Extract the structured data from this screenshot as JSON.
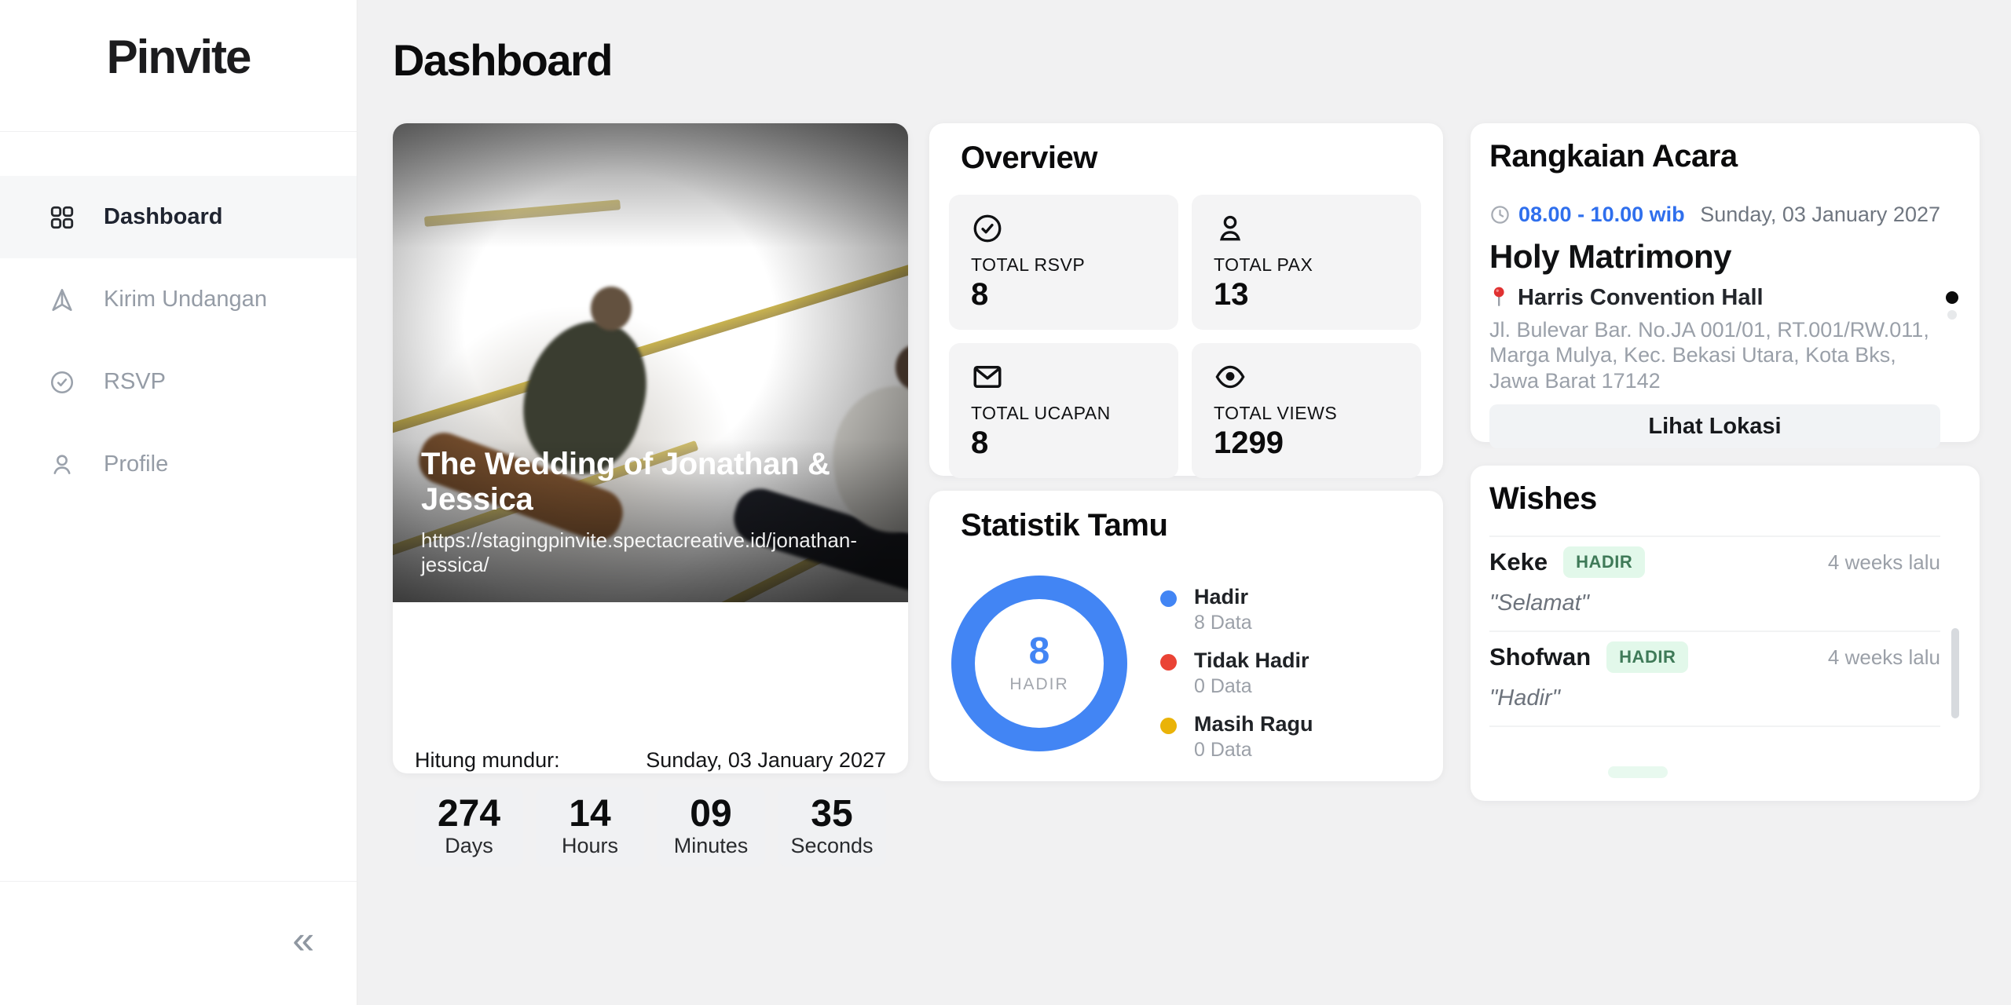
{
  "app": {
    "logo": "Pinvite"
  },
  "page": {
    "title": "Dashboard",
    "background": "#f1f1f2"
  },
  "colors": {
    "accent_blue": "#2f6fed",
    "donut_blue": "#4285f4",
    "legend_red": "#ea4335",
    "legend_yellow": "#eab308",
    "badge_green_bg": "#e2f8ea",
    "badge_green_text": "#3f7a58"
  },
  "sidebar": {
    "items": [
      {
        "label": "Dashboard",
        "icon": "grid-icon",
        "active": true
      },
      {
        "label": "Kirim Undangan",
        "icon": "send-icon",
        "active": false
      },
      {
        "label": "RSVP",
        "icon": "check-circle-icon",
        "active": false
      },
      {
        "label": "Profile",
        "icon": "user-icon",
        "active": false
      }
    ],
    "collapse_icon": "«"
  },
  "wedding_card": {
    "title": "The Wedding of Jonathan & Jessica",
    "url": "https://stagingpinvite.spectacreative.id/jonathan-jessica/",
    "countdown_label": "Hitung mundur:",
    "event_date": "Sunday, 03 January 2027",
    "countdown": [
      {
        "value": "274",
        "unit": "Days"
      },
      {
        "value": "14",
        "unit": "Hours"
      },
      {
        "value": "09",
        "unit": "Minutes"
      },
      {
        "value": "35",
        "unit": "Seconds"
      }
    ]
  },
  "overview": {
    "title": "Overview",
    "stats": [
      {
        "icon": "check-circle-icon",
        "label": "TOTAL RSVP",
        "value": "8"
      },
      {
        "icon": "person-icon",
        "label": "TOTAL PAX",
        "value": "13"
      },
      {
        "icon": "envelope-icon",
        "label": "TOTAL UCAPAN",
        "value": "8"
      },
      {
        "icon": "eye-icon",
        "label": "TOTAL VIEWS",
        "value": "1299"
      }
    ]
  },
  "statistik": {
    "title": "Statistik Tamu",
    "center_value": "8",
    "center_label": "HADIR",
    "legend": [
      {
        "label": "Hadir",
        "count": "8 Data",
        "color": "#4285f4"
      },
      {
        "label": "Tidak Hadir",
        "count": "0 Data",
        "color": "#ea4335"
      },
      {
        "label": "Masih Ragu",
        "count": "0 Data",
        "color": "#eab308"
      }
    ],
    "chart_data": {
      "type": "pie",
      "title": "Statistik Tamu",
      "categories": [
        "Hadir",
        "Tidak Hadir",
        "Masih Ragu"
      ],
      "values": [
        8,
        0,
        0
      ],
      "colors": [
        "#4285f4",
        "#ea4335",
        "#eab308"
      ],
      "center_value": "8",
      "center_label": "HADIR",
      "legend_position": "right"
    }
  },
  "acara": {
    "title": "Rangkaian Acara",
    "time": "08.00 - 10.00 wib",
    "date": "Sunday, 03 January 2027",
    "event_name": "Holy Matrimony",
    "venue": "Harris Convention Hall",
    "address": "Jl. Bulevar Bar. No.JA 001/01, RT.001/RW.011, Marga Mulya, Kec. Bekasi Utara, Kota Bks, Jawa Barat 17142",
    "button": "Lihat Lokasi"
  },
  "wishes": {
    "title": "Wishes",
    "items": [
      {
        "name": "Keke",
        "badge": "HADIR",
        "time": "4 weeks lalu",
        "message": "\"Selamat\""
      },
      {
        "name": "Shofwan",
        "badge": "HADIR",
        "time": "4 weeks lalu",
        "message": "\"Hadir\""
      }
    ]
  }
}
